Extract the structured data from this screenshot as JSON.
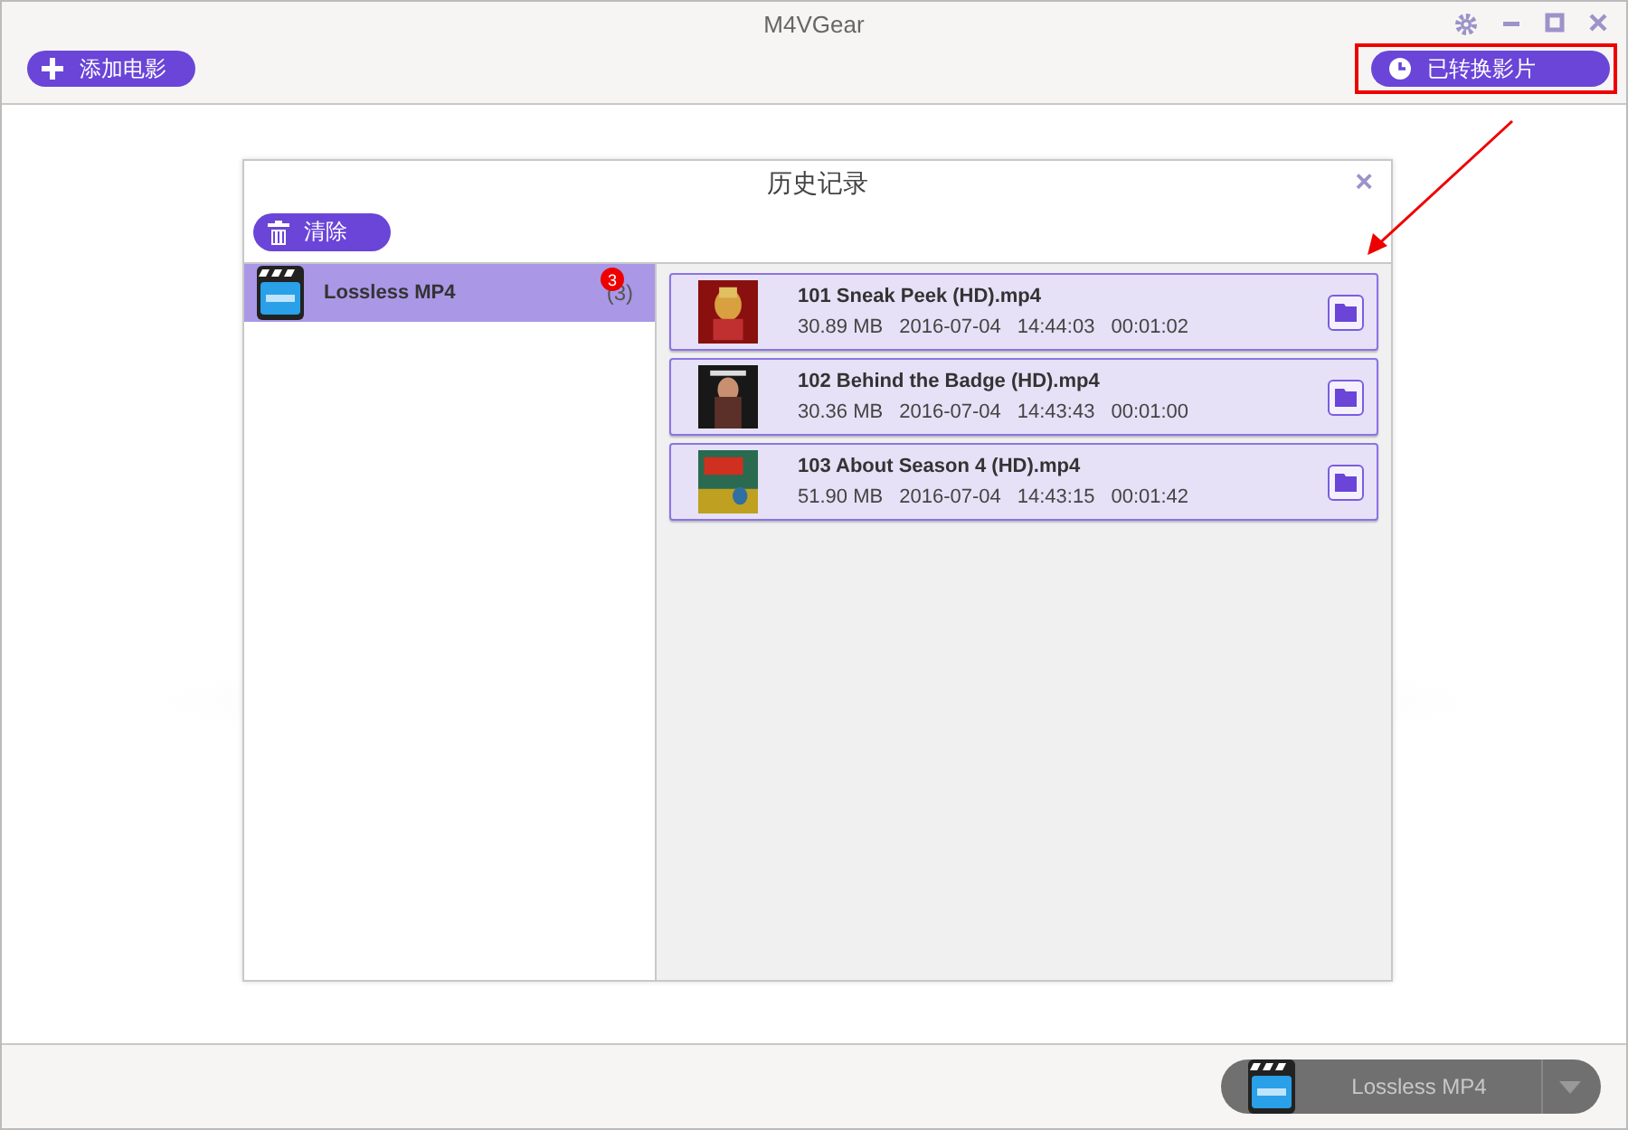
{
  "window": {
    "title": "M4VGear"
  },
  "toolbar": {
    "add_button": "添加电影",
    "history_button": "已转换影片"
  },
  "dialog": {
    "title": "历史记录",
    "close": "×",
    "clear_button": "清除",
    "formats": [
      {
        "name": "Lossless MP4",
        "count": "(3)",
        "badge": "3",
        "selected": true
      }
    ],
    "files": [
      {
        "name": "101 Sneak Peek (HD).mp4",
        "size": "30.89 MB",
        "date": "2016-07-04",
        "time": "14:44:03",
        "duration": "00:01:02"
      },
      {
        "name": "102 Behind the Badge (HD).mp4",
        "size": "30.36 MB",
        "date": "2016-07-04",
        "time": "14:43:43",
        "duration": "00:01:00"
      },
      {
        "name": "103 About Season 4 (HD).mp4",
        "size": "51.90 MB",
        "date": "2016-07-04",
        "time": "14:43:15",
        "duration": "00:01:42"
      }
    ]
  },
  "output_selector": {
    "label": "Lossless MP4"
  }
}
